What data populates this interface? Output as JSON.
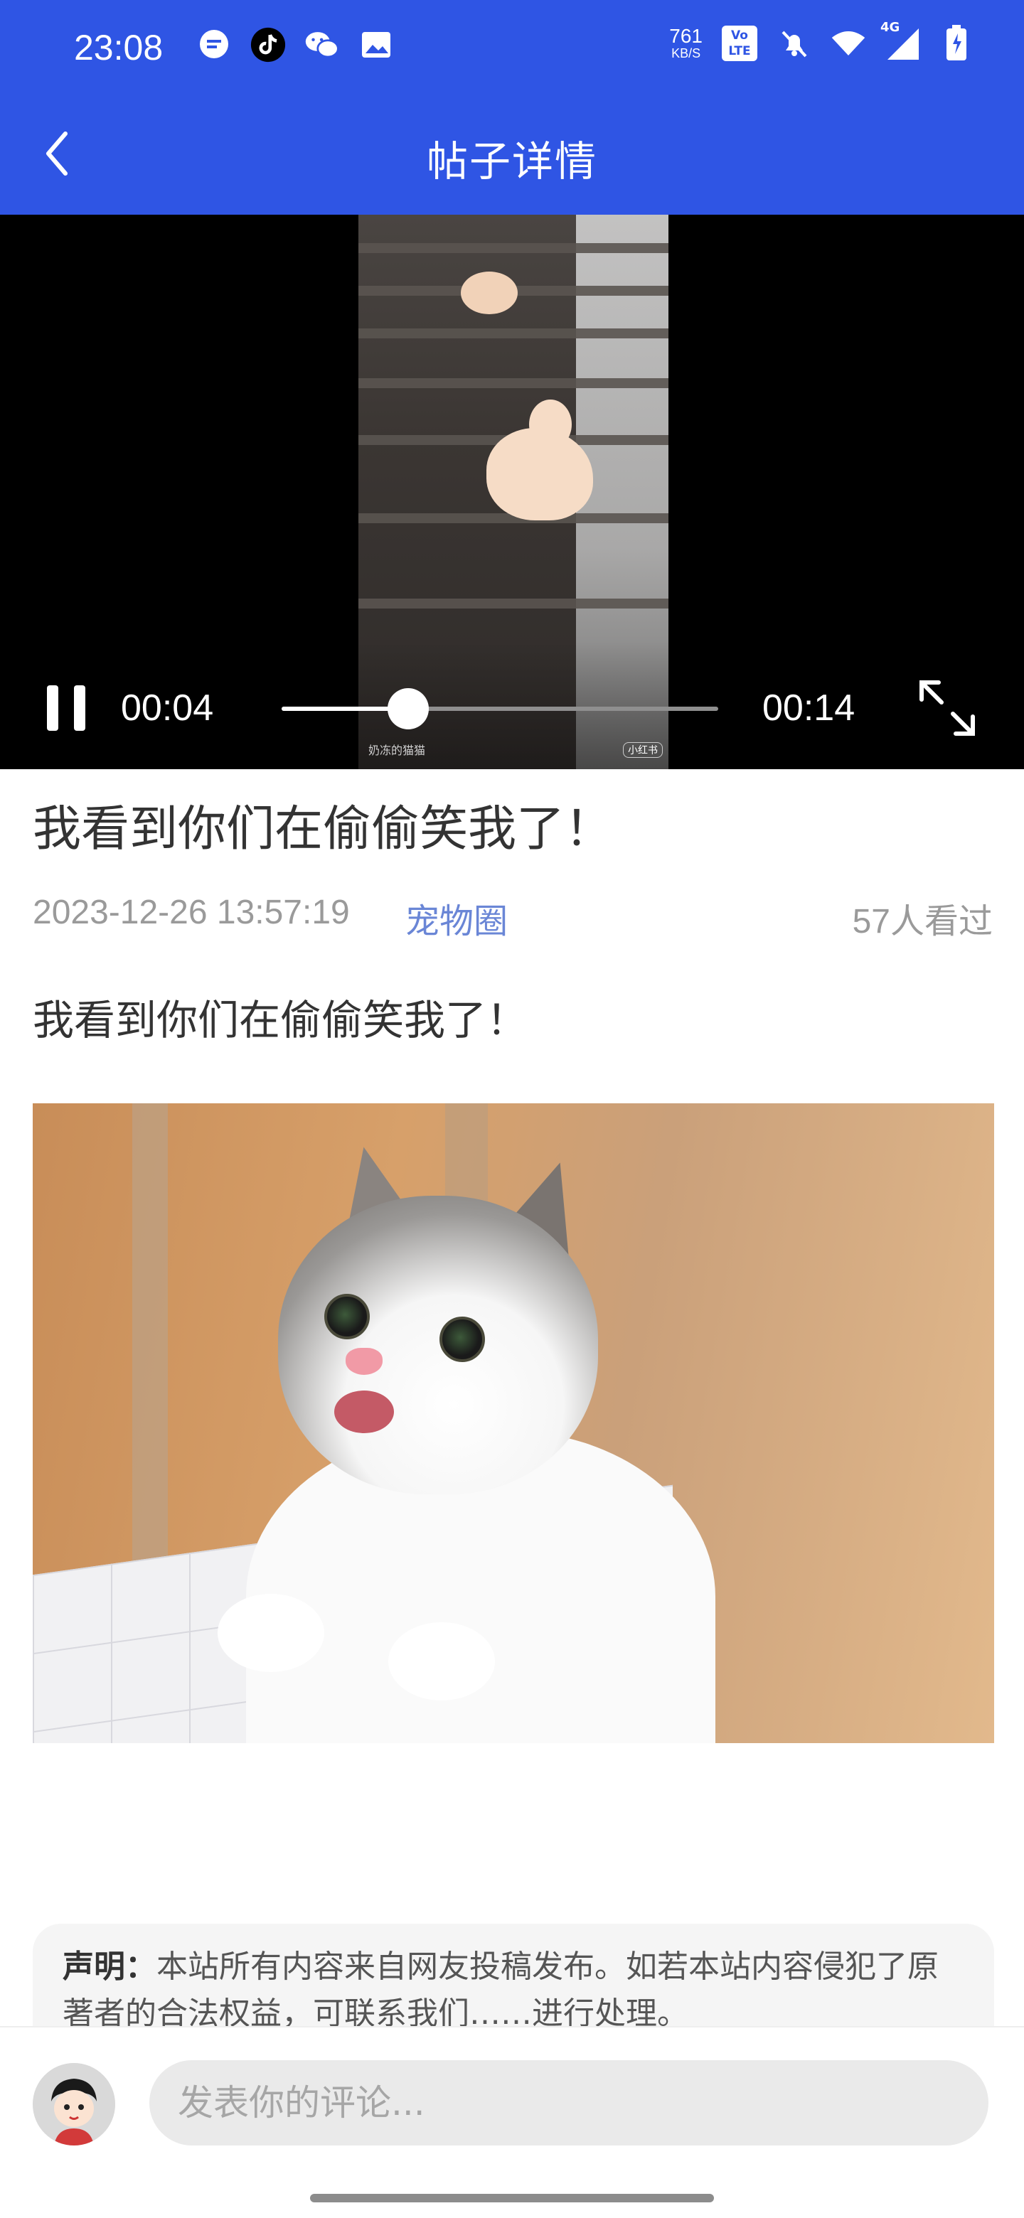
{
  "status_bar": {
    "time": "23:08",
    "speed_value": "761",
    "speed_unit": "KB/S",
    "volte": "Vo LTE",
    "network": "4G",
    "left_icons": [
      "message-icon",
      "tiktok-icon",
      "wechat-icon",
      "gallery-icon"
    ],
    "right_icons": [
      "bell-off-icon",
      "wifi-icon",
      "signal-icon",
      "battery-icon"
    ]
  },
  "header": {
    "title": "帖子详情",
    "back_icon": "chevron-left-icon",
    "color": "#2f55e4"
  },
  "video": {
    "current_time": "00:04",
    "duration": "00:14",
    "progress": 0.29,
    "state": "playing",
    "watermark_author": "奶冻的猫猫",
    "watermark_brand": "小红书"
  },
  "post": {
    "title": "我看到你们在偷偷笑我了！",
    "datetime": "2023-12-26 13:57:19",
    "category": "宠物圈",
    "views": "57人看过",
    "body": "我看到你们在偷偷笑我了！",
    "category_color": "#6a86d6"
  },
  "notice": {
    "label": "声明：",
    "text": "本站所有内容来自网友投稿发布。如若本站内容侵犯了原著者的合法权益，可联系我们……进行处理。"
  },
  "comment_bar": {
    "placeholder": "发表你的评论..."
  }
}
